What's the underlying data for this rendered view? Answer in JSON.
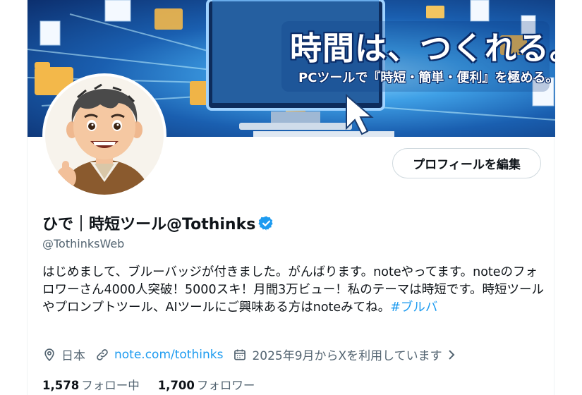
{
  "banner": {
    "title": "時間は、つくれる。",
    "subtitle": "PCツールで『時短・簡単・便利』を極める。"
  },
  "profile": {
    "edit_button_label": "プロフィールを編集",
    "display_name": "ひで｜時短ツール@Tothinks",
    "handle": "@TothinksWeb",
    "bio_text": "はじめまして、ブルーバッジが付きました。がんばります。noteやってます。noteのフォロワーさん4000人突破！5000スキ！月間3万ビュー！私のテーマは時短です。時短ツールやプロンプトツール、AIツールにご興味ある方はnoteみてね。",
    "bio_hashtag": "#ブルバ",
    "location": "日本",
    "website": "note.com/tothinks",
    "joined": "2025年9月からXを利用しています",
    "following_count": "1,578",
    "following_label": "フォロー中",
    "followers_count": "1,700",
    "followers_label": "フォロワー"
  },
  "colors": {
    "accent": "#1d9bf0",
    "secondary_text": "#536471",
    "primary_text": "#0f1419"
  }
}
